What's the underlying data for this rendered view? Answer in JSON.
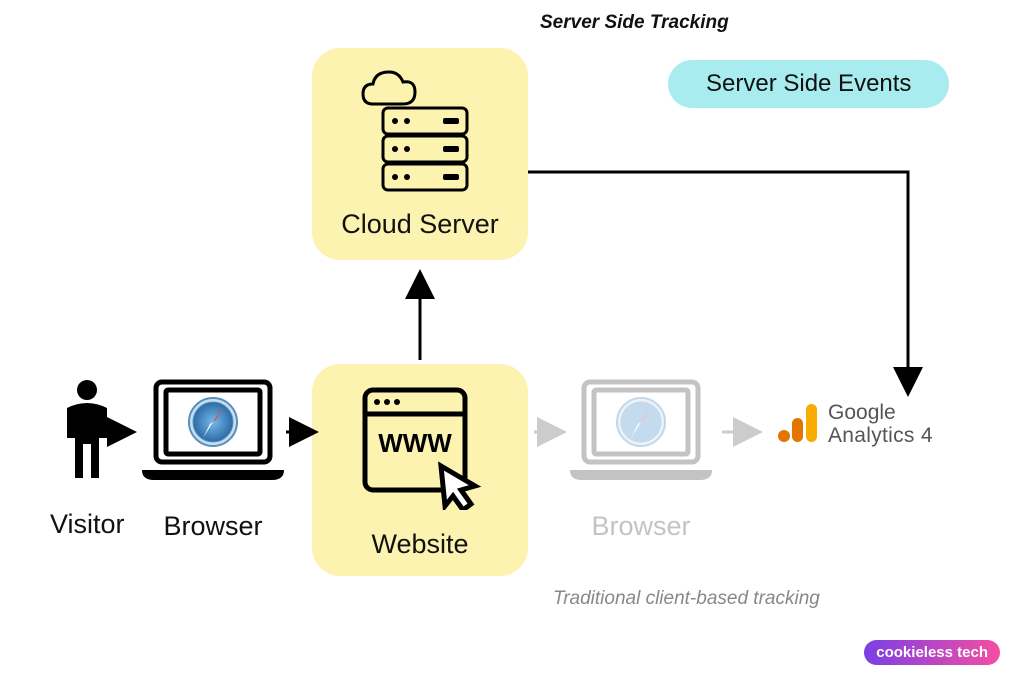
{
  "title": "Server Side Tracking",
  "badge": "Server Side Events",
  "cloud_server_label": "Cloud Server",
  "website_label": "Website",
  "visitor_label": "Visitor",
  "browser_label": "Browser",
  "browser2_label": "Browser",
  "ga_brand_line1": "Google",
  "ga_brand_line2": "Analytics 4",
  "subtitle": "Traditional client-based tracking",
  "watermark": "cookieless tech",
  "colors": {
    "highlight_bg": "#fdf3b0",
    "badge_bg": "#a8ecf0",
    "ga_orange": "#f9ab00",
    "ga_orange_dark": "#e37400"
  }
}
